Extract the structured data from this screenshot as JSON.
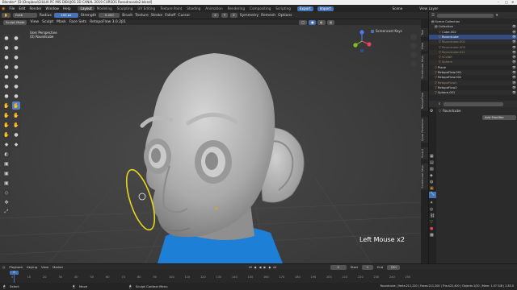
{
  "title_bar": {
    "text": "Blender* [D:\\Dropbox\\GIULIA PC MIS DIBUJOS 3D CANAL 2019 CURSOS Rosadrosada2.blend]"
  },
  "menu": [
    "File",
    "Edit",
    "Render",
    "Window",
    "Help"
  ],
  "workspaces": [
    "Layout",
    "Modeling",
    "Sculpting",
    "UV Editing",
    "Texture Paint",
    "Shading",
    "Animation",
    "Rendering",
    "Compositing",
    "Scripting"
  ],
  "active_workspace": "Layout",
  "export_btn": "Export",
  "import_btn": "Import",
  "scene": "Scene",
  "view_layer": "View Layer",
  "header": {
    "brush_name": "Grab",
    "radius_label": "Radius",
    "radius_value": "100 px",
    "strength_label": "Strength",
    "strength_value": "0.400",
    "brush": "Brush",
    "texture": "Texture",
    "stroke": "Stroke",
    "falloff": "Falloff",
    "cursor": "Cursor",
    "symmetry": "Symmetry",
    "remesh": "Remesh",
    "options": "Options"
  },
  "header2": {
    "mode": "Sculpt Mode",
    "view": "View",
    "sculpt": "Sculpt",
    "mask": "Mask",
    "face_sets": "Face Sets",
    "retopo": "RetopoFlow 3.0.2β1"
  },
  "viewport": {
    "line1": "User Perspective",
    "line2": "(0) Roundcube",
    "screencast": "Screencast Keys",
    "overlay_text": "Left Mouse x2"
  },
  "vtabs": [
    "Tool",
    "View",
    "Screencast Keys",
    "RetopoFlow",
    "Quad Remesher",
    "Sculpt",
    "Screencast Keys"
  ],
  "outliner": {
    "collection_root": "Scene Collection",
    "rows": [
      {
        "name": "Collection",
        "indent": 1,
        "sel": false
      },
      {
        "name": "Cube.002",
        "indent": 2,
        "sel": false
      },
      {
        "name": "Roundcube",
        "indent": 2,
        "sel": true
      },
      {
        "name": "Roundcube.002",
        "indent": 2,
        "sel": false
      },
      {
        "name": "Roundcube.003",
        "indent": 2,
        "sel": false
      },
      {
        "name": "Roundcube.011",
        "indent": 2,
        "sel": false
      },
      {
        "name": "SCANR",
        "indent": 2,
        "sel": false
      },
      {
        "name": "Sphere",
        "indent": 2,
        "sel": false
      },
      {
        "name": "Plane",
        "indent": 2,
        "sel": false
      },
      {
        "name": "RetopoFlow.001",
        "indent": 2,
        "sel": false
      },
      {
        "name": "RetopoFlow.002",
        "indent": 2,
        "sel": false
      },
      {
        "name": "RetopoFlow1",
        "indent": 2,
        "sel": false
      },
      {
        "name": "RetopoFlow2",
        "indent": 2,
        "sel": false
      },
      {
        "name": "Sphere.001",
        "indent": 2,
        "sel": false
      }
    ]
  },
  "props": {
    "object_name": "Roundcube",
    "add_modifier": "Add Modifier"
  },
  "timeline": {
    "playback": "Playback",
    "keying": "Keying",
    "view": "View",
    "marker": "Marker",
    "frame": "0",
    "start_label": "Start",
    "start_value": "1",
    "end_label": "End",
    "end_value": "250",
    "ticks": [
      "0",
      "10",
      "20",
      "30",
      "40",
      "50",
      "60",
      "70",
      "80",
      "90",
      "100",
      "110",
      "120",
      "130",
      "140",
      "150",
      "160",
      "170",
      "180",
      "190",
      "200",
      "210",
      "220",
      "230",
      "240",
      "250"
    ]
  },
  "status": {
    "select": "Select",
    "move": "Move",
    "context_menu": "Sculpt Context Menu",
    "stats": "Roundcube | Verts:211,220 | Faces:211,200 | Tris:422,400 | Objects:1/20 | Mem: 1.07 GiB | 2.83.0"
  },
  "colors": {
    "accent": "#4772b3",
    "annotation": "#e8d61f",
    "shirt": "#1e7fd6"
  }
}
